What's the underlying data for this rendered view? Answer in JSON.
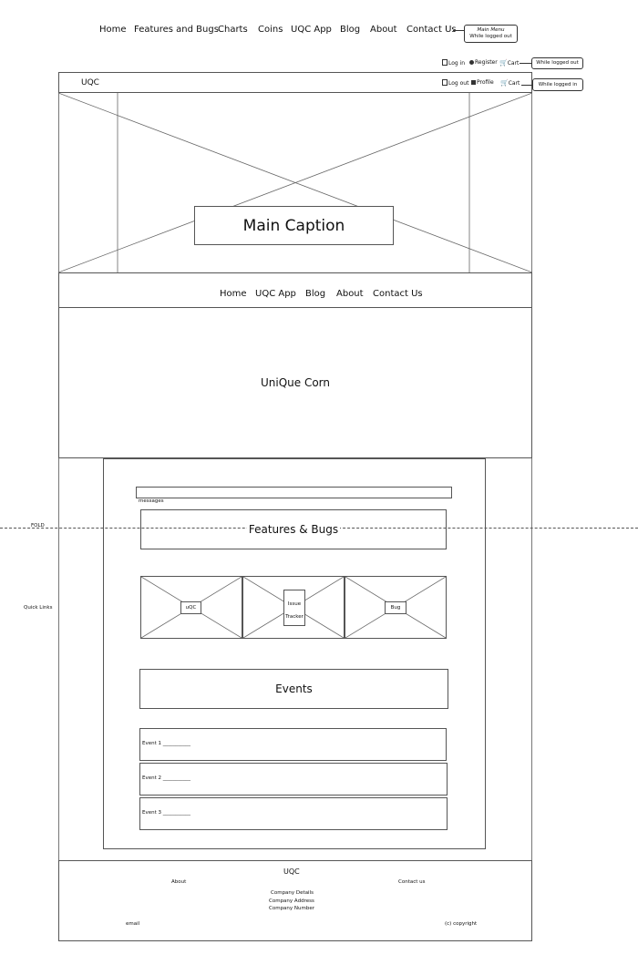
{
  "main_menu": {
    "items": [
      "Home",
      "Features and Bugs",
      "Charts",
      "Coins",
      "UQC App",
      "Blog",
      "About",
      "Contact Us"
    ],
    "callout_title": "Main Menu",
    "callout_sub": "While logged out"
  },
  "auth_logged_out": {
    "login": "Log in",
    "register": "Register",
    "cart": "Cart",
    "callout": "While logged out"
  },
  "header": {
    "brand": "UQC",
    "logout": "Log out",
    "profile": "Profile",
    "cart": "Cart",
    "callout": "While logged in"
  },
  "hero": {
    "caption": "Main Caption"
  },
  "secondary_nav": {
    "items": [
      "Home",
      "UQC App",
      "Blog",
      "About",
      "Contact Us"
    ]
  },
  "banner": {
    "title": "UniQue Corn"
  },
  "content": {
    "messages_placeholder": "messages",
    "fold_label": "FOLD",
    "quick_links_label": "Quick Links",
    "features_title": "Features & Bugs",
    "quick_links": {
      "uqc": "uQC",
      "issue": "Issue",
      "tracker": "Tracker",
      "bug": "Bug"
    },
    "events_title": "Events",
    "events": [
      "Event 1 ___________",
      "Event 2 ___________",
      "Event 3 ___________"
    ]
  },
  "footer": {
    "brand": "UQC",
    "about": "About",
    "contact": "Contact us",
    "company_details": "Company Details",
    "company_address": "Company Address",
    "company_number": "Company Number",
    "email": "email",
    "copyright": "(c) copyright"
  },
  "colors": {
    "stroke": "#555555",
    "background": "#ffffff",
    "text": "#111111"
  }
}
